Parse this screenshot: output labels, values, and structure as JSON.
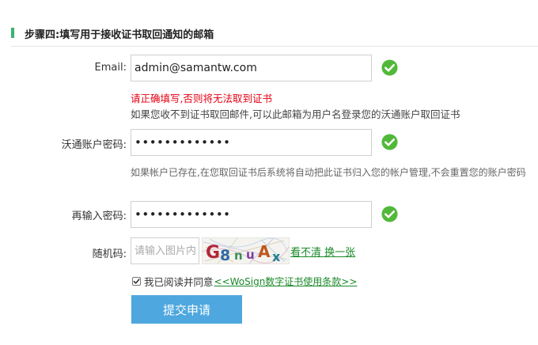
{
  "section": {
    "title": "步骤四:填写用于接收证书取回通知的邮箱"
  },
  "email": {
    "label": "Email:",
    "value": "admin@samantw.com"
  },
  "email_error": "请正确填写,否则将无法取到证书",
  "email_hint": "如果您收不到证书取回邮件,可以此邮箱为用户名登录您的沃通账户取回证书",
  "password": {
    "label": "沃通账户密码:",
    "value": "•••••••••••••"
  },
  "password_hint": "如果帐户已存在,在您取回证书后系统将自动把此证书归入您的帐户管理,不会重置您的账户密码",
  "confirm_password": {
    "label": "再输入密码:",
    "value": "•••••••••••••"
  },
  "captcha": {
    "label": "随机码:",
    "placeholder": "请输入图片内容",
    "image_text": "G8nuAx",
    "refresh_link": "看不清 换一张"
  },
  "agreement": {
    "checked": true,
    "text": "我已阅读并同意",
    "link": "<<WoSign数字证书使用条款>>"
  },
  "submit": {
    "label": "提交申请"
  },
  "colors": {
    "valid": "#52b83a",
    "error": "#e60012",
    "link": "#1a8a2a",
    "button": "#4ea7df",
    "accent_bar": "#3cb371"
  },
  "icons": {
    "valid": "check-circle-icon"
  }
}
